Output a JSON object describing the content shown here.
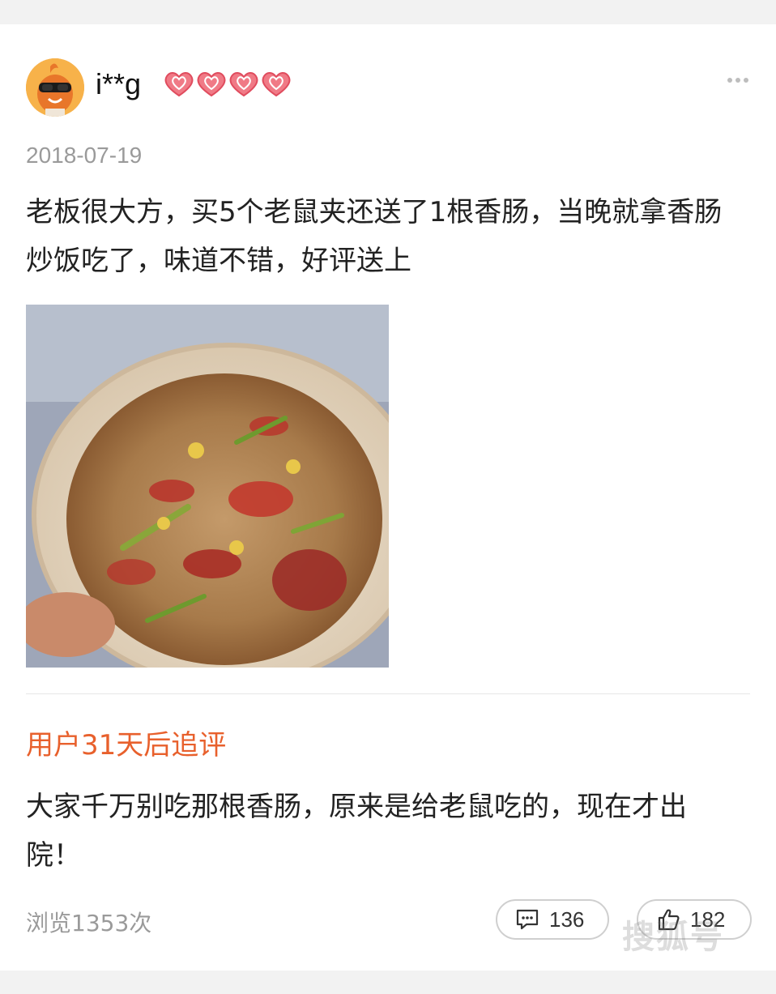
{
  "user": {
    "name": "i**g",
    "avatar_icon": "avatar-mascot-icon",
    "level_badges": [
      "heart-badge-icon",
      "heart-badge-icon",
      "heart-badge-icon",
      "heart-badge-icon"
    ]
  },
  "more_icon": "more-dots-icon",
  "review": {
    "date": "2018-07-19",
    "text": "老板很大方，买5个老鼠夹还送了1根香肠，当晚就拿香肠炒饭吃了，味道不错，好评送上",
    "photo": "fried-rice-photo"
  },
  "followup": {
    "title": "用户31天后追评",
    "text": "大家千万别吃那根香肠，原来是给老鼠吃的，现在才出院！"
  },
  "stats": {
    "views": "浏览1353次",
    "comments": "136",
    "likes": "182"
  },
  "watermark": "搜狐号",
  "colors": {
    "accent": "#e8602c",
    "meta": "#9a9a9a",
    "heart": "#e85a6a"
  }
}
